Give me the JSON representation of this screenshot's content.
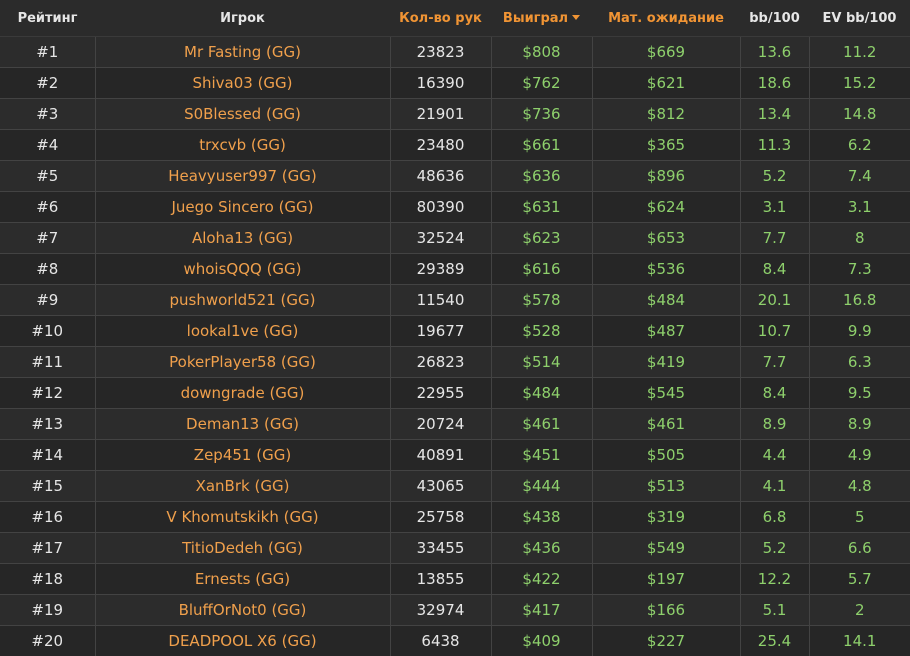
{
  "table": {
    "headers": {
      "rank": "Рейтинг",
      "player": "Игрок",
      "hands": "Кол-во рук",
      "won": "Выиграл",
      "ev": "Мат. ожидание",
      "bb100": "bb/100",
      "evbb100": "EV bb/100"
    },
    "sorted_column": "won",
    "sort_direction": "desc",
    "colors": {
      "background": "#2b2b2b",
      "header_sortable": "#f09434",
      "player_link": "#f0a04c",
      "positive_value": "#8ed06c",
      "text": "#e6e6e6"
    },
    "rows": [
      {
        "rank": "#1",
        "player": "Mr Fasting (GG)",
        "hands": "23823",
        "won": "$808",
        "ev": "$669",
        "bb100": "13.6",
        "evbb100": "11.2"
      },
      {
        "rank": "#2",
        "player": "Shiva03 (GG)",
        "hands": "16390",
        "won": "$762",
        "ev": "$621",
        "bb100": "18.6",
        "evbb100": "15.2"
      },
      {
        "rank": "#3",
        "player": "S0Blessed (GG)",
        "hands": "21901",
        "won": "$736",
        "ev": "$812",
        "bb100": "13.4",
        "evbb100": "14.8"
      },
      {
        "rank": "#4",
        "player": "trxcvb (GG)",
        "hands": "23480",
        "won": "$661",
        "ev": "$365",
        "bb100": "11.3",
        "evbb100": "6.2"
      },
      {
        "rank": "#5",
        "player": "Heavyuser997 (GG)",
        "hands": "48636",
        "won": "$636",
        "ev": "$896",
        "bb100": "5.2",
        "evbb100": "7.4"
      },
      {
        "rank": "#6",
        "player": "Juego Sincero (GG)",
        "hands": "80390",
        "won": "$631",
        "ev": "$624",
        "bb100": "3.1",
        "evbb100": "3.1"
      },
      {
        "rank": "#7",
        "player": "Aloha13 (GG)",
        "hands": "32524",
        "won": "$623",
        "ev": "$653",
        "bb100": "7.7",
        "evbb100": "8"
      },
      {
        "rank": "#8",
        "player": "whoisQQQ (GG)",
        "hands": "29389",
        "won": "$616",
        "ev": "$536",
        "bb100": "8.4",
        "evbb100": "7.3"
      },
      {
        "rank": "#9",
        "player": "pushworld521 (GG)",
        "hands": "11540",
        "won": "$578",
        "ev": "$484",
        "bb100": "20.1",
        "evbb100": "16.8"
      },
      {
        "rank": "#10",
        "player": "lookal1ve (GG)",
        "hands": "19677",
        "won": "$528",
        "ev": "$487",
        "bb100": "10.7",
        "evbb100": "9.9"
      },
      {
        "rank": "#11",
        "player": "PokerPlayer58 (GG)",
        "hands": "26823",
        "won": "$514",
        "ev": "$419",
        "bb100": "7.7",
        "evbb100": "6.3"
      },
      {
        "rank": "#12",
        "player": "downgrade (GG)",
        "hands": "22955",
        "won": "$484",
        "ev": "$545",
        "bb100": "8.4",
        "evbb100": "9.5"
      },
      {
        "rank": "#13",
        "player": "Deman13 (GG)",
        "hands": "20724",
        "won": "$461",
        "ev": "$461",
        "bb100": "8.9",
        "evbb100": "8.9"
      },
      {
        "rank": "#14",
        "player": "Zep451 (GG)",
        "hands": "40891",
        "won": "$451",
        "ev": "$505",
        "bb100": "4.4",
        "evbb100": "4.9"
      },
      {
        "rank": "#15",
        "player": "XanBrk (GG)",
        "hands": "43065",
        "won": "$444",
        "ev": "$513",
        "bb100": "4.1",
        "evbb100": "4.8"
      },
      {
        "rank": "#16",
        "player": "V Khomutskikh (GG)",
        "hands": "25758",
        "won": "$438",
        "ev": "$319",
        "bb100": "6.8",
        "evbb100": "5"
      },
      {
        "rank": "#17",
        "player": "TitioDedeh (GG)",
        "hands": "33455",
        "won": "$436",
        "ev": "$549",
        "bb100": "5.2",
        "evbb100": "6.6"
      },
      {
        "rank": "#18",
        "player": "Ernests (GG)",
        "hands": "13855",
        "won": "$422",
        "ev": "$197",
        "bb100": "12.2",
        "evbb100": "5.7"
      },
      {
        "rank": "#19",
        "player": "BluffOrNot0 (GG)",
        "hands": "32974",
        "won": "$417",
        "ev": "$166",
        "bb100": "5.1",
        "evbb100": "2"
      },
      {
        "rank": "#20",
        "player": "DEADPOOL X6 (GG)",
        "hands": "6438",
        "won": "$409",
        "ev": "$227",
        "bb100": "25.4",
        "evbb100": "14.1"
      }
    ]
  }
}
